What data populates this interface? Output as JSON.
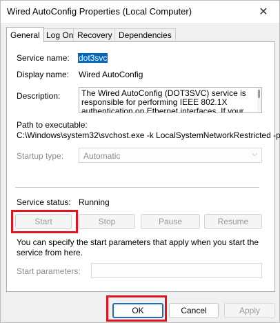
{
  "window": {
    "title": "Wired AutoConfig Properties (Local Computer)"
  },
  "titlebar": {
    "close_icon": "close-icon",
    "close_glyph": "✕"
  },
  "tabs": [
    {
      "label": "General",
      "active": true
    },
    {
      "label": "Log On"
    },
    {
      "label": "Recovery"
    },
    {
      "label": "Dependencies"
    }
  ],
  "general": {
    "service_name_label": "Service name:",
    "service_name_value": "dot3svc",
    "display_name_label": "Display name:",
    "display_name_value": "Wired AutoConfig",
    "description_label": "Description:",
    "description_value": "The Wired AutoConfig (DOT3SVC) service is responsible for performing IEEE 802.1X authentication on Ethernet interfaces. If your current",
    "path_label": "Path to executable:",
    "path_value": "C:\\Windows\\system32\\svchost.exe -k LocalSystemNetworkRestricted -p",
    "startup_type_label": "Startup type:",
    "startup_type_value": "Automatic",
    "status_label": "Service status:",
    "status_value": "Running",
    "buttons": {
      "start": "Start",
      "stop": "Stop",
      "pause": "Pause",
      "resume": "Resume"
    },
    "hint": "You can specify the start parameters that apply when you start the service from here.",
    "start_params_label": "Start parameters:",
    "start_params_value": ""
  },
  "dialog_buttons": {
    "ok": "OK",
    "cancel": "Cancel",
    "apply": "Apply"
  },
  "colors": {
    "highlight": "#e0141e",
    "selection": "#0067c0"
  }
}
